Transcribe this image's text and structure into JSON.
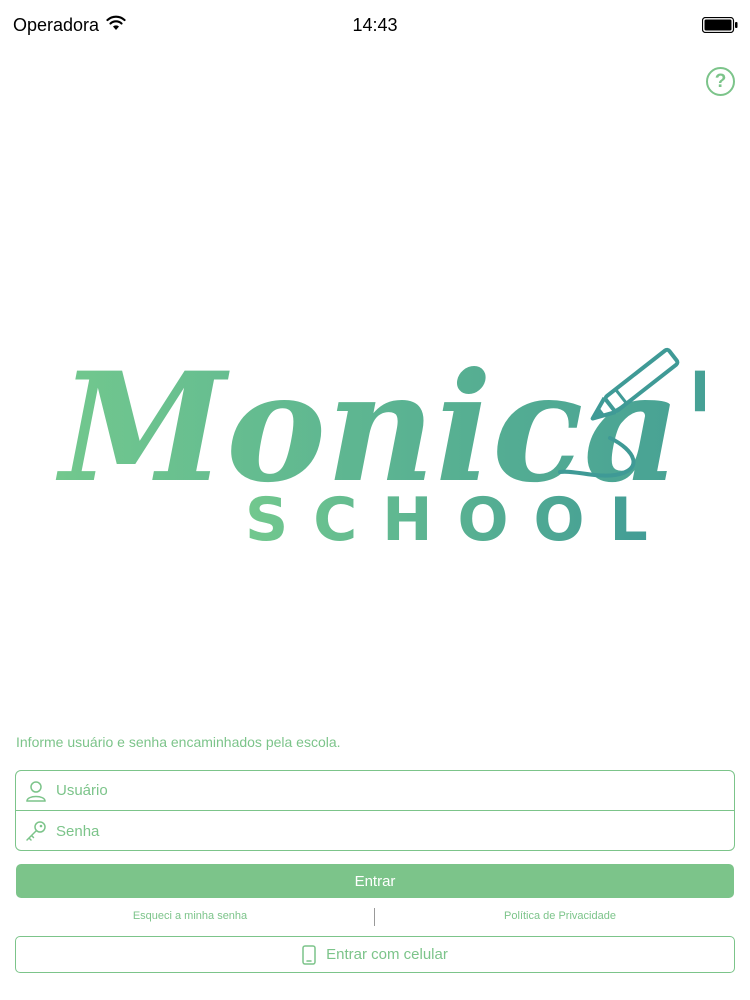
{
  "status_bar": {
    "carrier": "Operadora",
    "time": "14:43"
  },
  "help": {
    "label": "?"
  },
  "logo": {
    "script_text": "Monica's",
    "subtitle": "SCHOOL"
  },
  "login": {
    "instructions": "Informe usuário e senha encaminhados pela escola.",
    "username_placeholder": "Usuário",
    "password_placeholder": "Senha",
    "submit_label": "Entrar",
    "forgot_password_label": "Esqueci a minha senha",
    "privacy_policy_label": "Política de Privacidade",
    "phone_login_label": "Entrar com celular"
  },
  "icons": {
    "wifi": "wifi-icon",
    "battery": "battery-icon",
    "user": "user-icon",
    "key": "key-icon",
    "phone": "phone-icon",
    "pencil": "pencil-icon"
  },
  "colors": {
    "accent": "#7cc48a",
    "logo_start": "#72c88e",
    "logo_end": "#3f9a96"
  }
}
